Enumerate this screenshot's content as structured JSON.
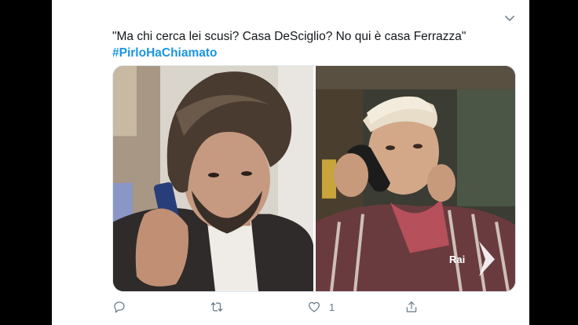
{
  "tweet": {
    "text_line1": "\"Ma chi cerca lei scusi? Casa DeSciglio? No qui è casa Ferrazza\"",
    "hashtag": "#PirloHaChiamato"
  },
  "media": {
    "right_watermark": "Rai"
  },
  "actions": {
    "like_count": "1",
    "icons": [
      "reply-icon",
      "retweet-icon",
      "like-icon",
      "share-icon"
    ]
  }
}
